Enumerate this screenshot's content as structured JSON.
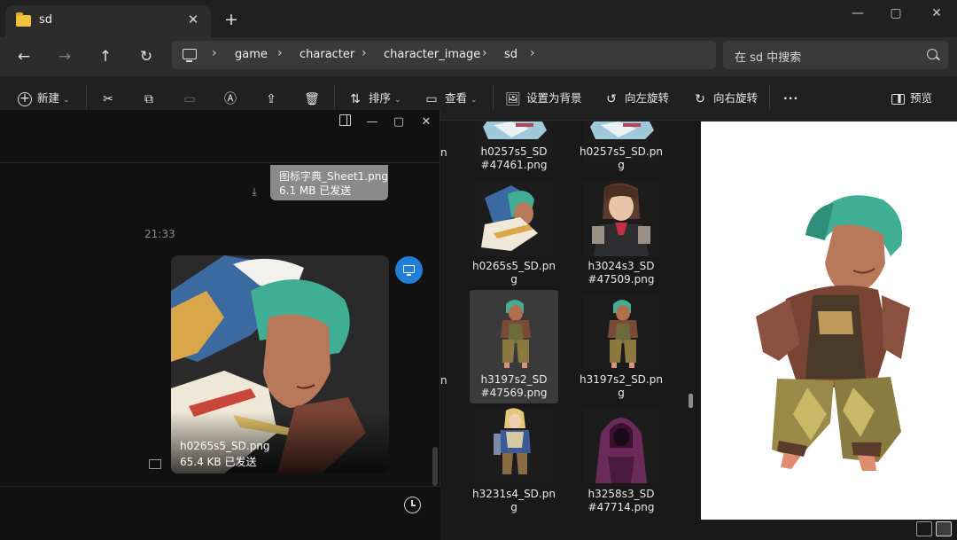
{
  "explorer": {
    "tab_title": "sd",
    "address": {
      "crumbs": [
        "game",
        "character",
        "character_image",
        "sd"
      ]
    },
    "search_placeholder": "在 sd 中搜索",
    "toolbar": {
      "new_label": "新建",
      "sort_label": "排序",
      "view_label": "查看",
      "set_bg_label": "设置为背景",
      "rotate_left_label": "向左旋转",
      "rotate_right_label": "向右旋转",
      "preview_label": "预览"
    },
    "files": [
      {
        "name": "h0257s5_SD\n#47461.png"
      },
      {
        "name": "h0257s5_SD.pn\ng"
      },
      {
        "name": "h0265s5_SD.pn\ng"
      },
      {
        "name": "h3024s3_SD\n#47509.png"
      },
      {
        "name": "h3197s2_SD\n#47569.png",
        "selected": true
      },
      {
        "name": "h3197s2_SD.pn\ng"
      },
      {
        "name": "h3231s4_SD.pn\ng"
      },
      {
        "name": "h3258s3_SD\n#47714.png"
      }
    ]
  },
  "chat": {
    "file_message": {
      "name": "图标字典_Sheet1.png",
      "status": "6.1 MB 已发送"
    },
    "timestamp": "21:33",
    "image_message": {
      "name": "h0265s5_SD.png",
      "status": "65.4 KB 已发送"
    }
  },
  "colors": {
    "accent_blue": "#1f7fd6",
    "folder_yellow": "#f0c23c",
    "char_teal_hair": "#3fae95"
  }
}
